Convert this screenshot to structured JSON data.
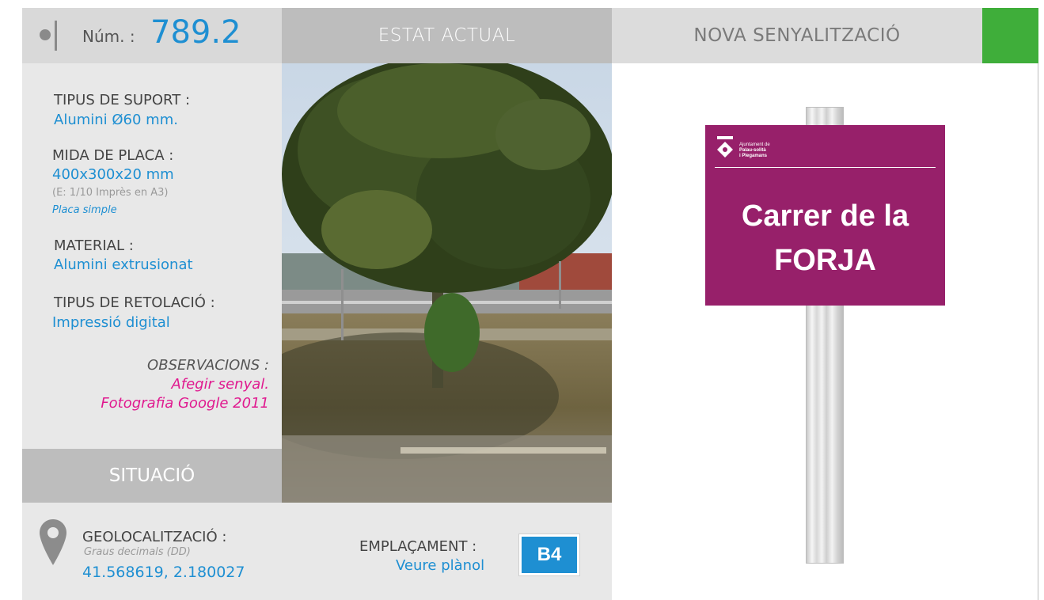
{
  "header": {
    "num_label": "Núm. :",
    "num_value": "789.2",
    "estat_label": "ESTAT ACTUAL",
    "nova_label": "NOVA SENYALITZACIÓ",
    "accent_color": "#3fae3a"
  },
  "specs": {
    "suport_label": "TIPUS DE SUPORT :",
    "suport_value": "Alumini Ø60 mm.",
    "placa_label": "MIDA DE PLACA :",
    "placa_value": "400x300x20 mm",
    "placa_scale": "(E: 1/10 Imprès en A3)",
    "placa_type": "Placa simple",
    "material_label": "MATERIAL :",
    "material_value": "Alumini extrusionat",
    "retol_label": "TIPUS DE RETOLACIÓ :",
    "retol_value": "Impressió digital",
    "obs_label": "OBSERVACIONS :",
    "obs_line1": "Afegir senyal.",
    "obs_line2": "Fotografia Google 2011"
  },
  "situacio": {
    "title": "SITUACIÓ",
    "geo_label": "GEOLOCALITZACIÓ :",
    "geo_sub": "Graus decimals (DD)",
    "geo_value": "41.568619, 2.180027",
    "empl_label": "EMPLAÇAMENT :",
    "empl_link": "Veure plànol",
    "empl_code": "B4"
  },
  "sign": {
    "org_line1": "Ajuntament de",
    "org_line2": "Palau-solità",
    "org_line3": "i Plegamans",
    "line1": "Carrer de la",
    "line2": "FORJA",
    "color": "#97206a"
  },
  "icons": [
    "location-pin-icon",
    "bullet-icon",
    "municipal-logo-icon"
  ]
}
